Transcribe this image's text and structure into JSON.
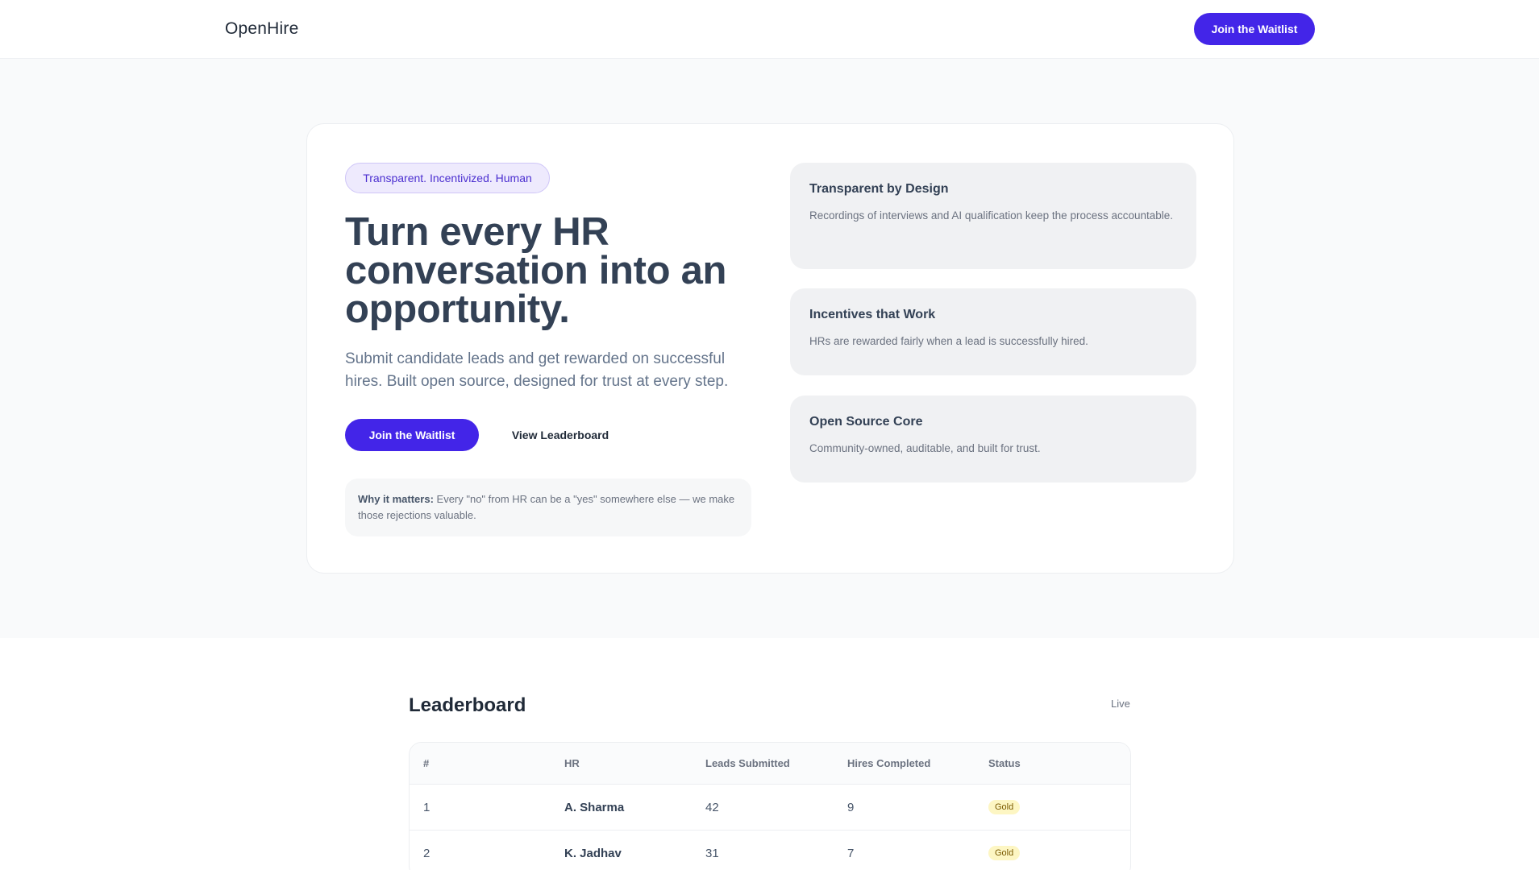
{
  "nav": {
    "brand": "OpenHire",
    "cta_label": "Join the Waitlist"
  },
  "hero": {
    "pill": "Transparent.  Incentivized.  Human",
    "headline": "Turn every HR conversation into an opportunity.",
    "subtext": "Submit candidate leads and get rewarded on successful hires. Built open source, designed for trust at every step.",
    "primary_cta": "Join the Waitlist",
    "secondary_cta": "View Leaderboard",
    "why_label": "Why it matters:",
    "why_text": " Every \"no\" from HR can be a \"yes\" somewhere else — we make those rejections valuable."
  },
  "features": [
    {
      "title": "Transparent by Design",
      "desc": "Recordings of interviews and AI qualification keep the process accountable."
    },
    {
      "title": "Incentives that Work",
      "desc": "HRs are rewarded fairly when a lead is successfully hired."
    },
    {
      "title": "Open Source Core",
      "desc": "Community-owned, auditable, and built for trust."
    }
  ],
  "leaderboard": {
    "title": "Leaderboard",
    "live_label": "Live",
    "headers": [
      "#",
      "HR",
      "Leads Submitted",
      "Hires Completed",
      "Status"
    ],
    "rows": [
      {
        "rank": "1",
        "name": "A. Sharma",
        "leads": "42",
        "hires": "9",
        "status": "Gold"
      },
      {
        "rank": "2",
        "name": "K. Jadhav",
        "leads": "31",
        "hires": "7",
        "status": "Gold"
      }
    ]
  },
  "colors": {
    "accent": "#4325e8",
    "badge_gold_bg": "#fdf6c3"
  }
}
